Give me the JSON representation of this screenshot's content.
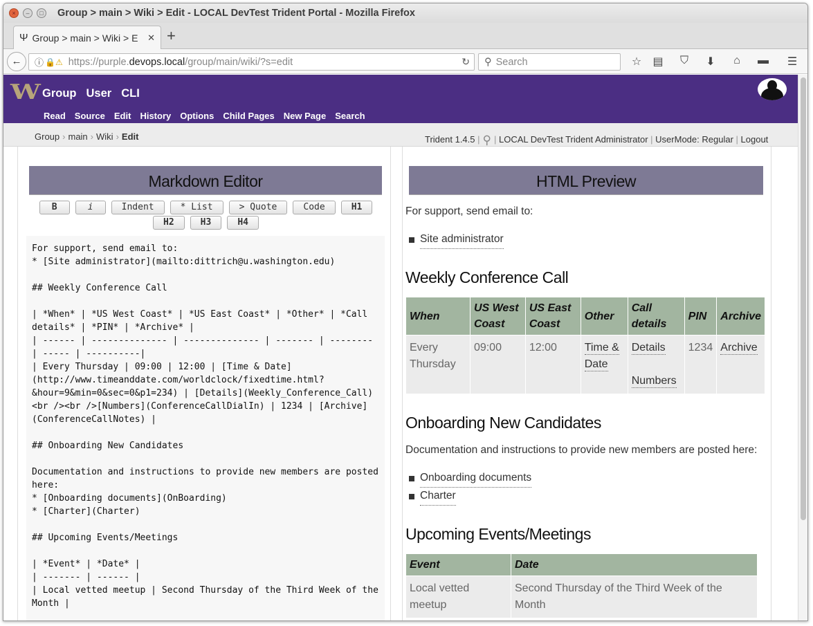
{
  "window": {
    "title": "Group > main > Wiki > Edit - LOCAL DevTest Trident Portal - Mozilla Firefox"
  },
  "tab": {
    "title": "Group > main > Wiki > E",
    "favicon": "Ψ",
    "close": "✕",
    "new_tab": "+"
  },
  "url": {
    "prefix": "https://purple.",
    "domain": "devops.local",
    "path": "/group/main/wiki/?s=edit"
  },
  "search": {
    "placeholder": "Search"
  },
  "site": {
    "logo": "W",
    "top_nav": [
      "Group",
      "User",
      "CLI"
    ],
    "sub_nav": [
      "Read",
      "Source",
      "Edit",
      "History",
      "Options",
      "Child Pages",
      "New Page",
      "Search"
    ]
  },
  "breadcrumb": {
    "items": [
      "Group",
      "main",
      "Wiki"
    ],
    "current": "Edit",
    "sep": "›"
  },
  "status": {
    "version": "Trident 1.4.5",
    "user": "LOCAL DevTest Trident Administrator",
    "usermode_label": "UserMode:",
    "usermode_value": "Regular",
    "logout": "Logout"
  },
  "editor": {
    "title": "Markdown Editor",
    "buttons": {
      "bold": "B",
      "italic": "i",
      "indent": "Indent",
      "list": "* List",
      "quote": "> Quote",
      "code": "Code",
      "h1": "H1",
      "h2": "H2",
      "h3": "H3",
      "h4": "H4"
    },
    "content": "For support, send email to:\n* [Site administrator](mailto:dittrich@u.washington.edu)\n\n## Weekly Conference Call\n\n| *When* | *US West Coast* | *US East Coast* | *Other* | *Call details* | *PIN* | *Archive* |\n| ------ | -------------- | -------------- | ------- | -------- | ----- | ----------|\n| Every Thursday | 09:00 | 12:00 | [Time & Date](http://www.timeanddate.com/worldclock/fixedtime.html?&hour=9&min=0&sec=0&p1=234) | [Details](Weekly_Conference_Call)<br /><br />[Numbers](ConferenceCallDialIn) | 1234 | [Archive](ConferenceCallNotes) |\n\n## Onboarding New Candidates\n\nDocumentation and instructions to provide new members are posted here:\n* [Onboarding documents](OnBoarding)\n* [Charter](Charter)\n\n## Upcoming Events/Meetings\n\n| *Event* | *Date* |\n| ------- | ------ |\n| Local vetted meetup | Second Thursday of the Third Week of the Month |"
  },
  "preview": {
    "title": "HTML Preview",
    "support_text": "For support, send email to:",
    "support_link": "Site administrator",
    "h_weekly": "Weekly Conference Call",
    "weekly_headers": [
      "When",
      "US West Coast",
      "US East Coast",
      "Other",
      "Call details",
      "PIN",
      "Archive"
    ],
    "weekly_row": {
      "when": "Every Thursday",
      "west": "09:00",
      "east": "12:00",
      "other": "Time & Date",
      "details": "Details",
      "numbers": "Numbers",
      "pin": "1234",
      "archive": "Archive"
    },
    "h_onboarding": "Onboarding New Candidates",
    "onboarding_text": "Documentation and instructions to provide new members are posted here:",
    "onboarding_links": [
      "Onboarding documents",
      "Charter"
    ],
    "h_events": "Upcoming Events/Meetings",
    "events_headers": [
      "Event",
      "Date"
    ],
    "events_row": {
      "event": "Local vetted meetup",
      "date": "Second Thursday of the Third Week of the Month"
    }
  }
}
